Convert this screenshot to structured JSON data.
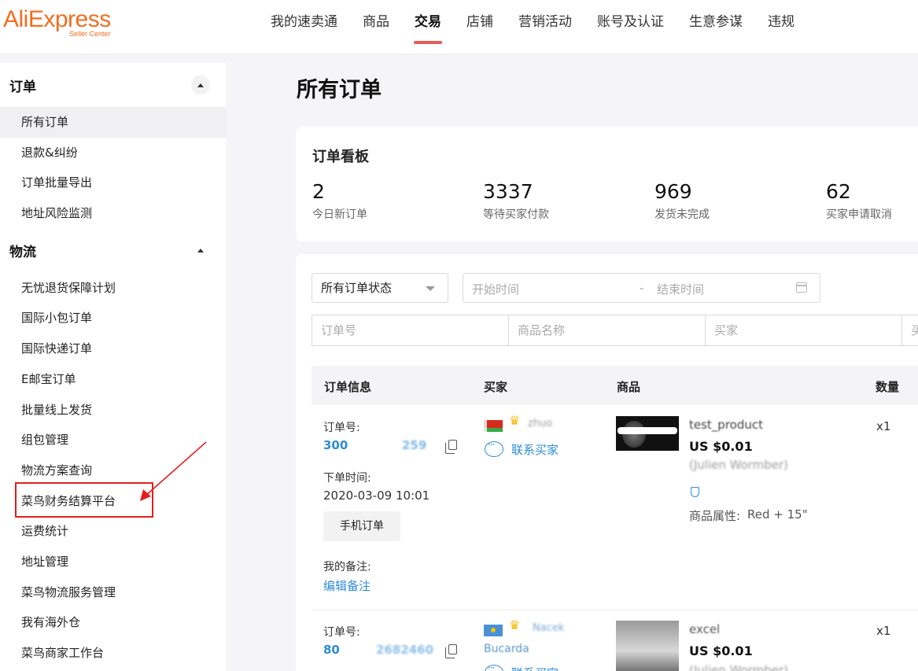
{
  "brand": {
    "name": "AliExpress",
    "sub": "Seller Center",
    "color": "#f26d21"
  },
  "nav": {
    "items": [
      "我的速卖通",
      "商品",
      "交易",
      "店铺",
      "营销活动",
      "账号及认证",
      "生意参谋",
      "违规"
    ],
    "active": "交易"
  },
  "sidebar": {
    "groups": [
      {
        "title": "订单",
        "items": [
          "所有订单",
          "退款&纠纷",
          "订单批量导出",
          "地址风险监测"
        ]
      },
      {
        "title": "物流",
        "items": [
          "无忧退货保障计划",
          "国际小包订单",
          "国际快递订单",
          "E邮宝订单",
          "批量线上发货",
          "组包管理",
          "物流方案查询",
          "菜鸟财务结算平台",
          "运费统计",
          "地址管理",
          "菜鸟物流服务管理",
          "我有海外仓",
          "菜鸟商家工作台"
        ]
      }
    ],
    "active_item": "所有订单",
    "highlighted_item": "菜鸟财务结算平台",
    "annotation_color": "#e41e1e"
  },
  "page": {
    "title": "所有订单"
  },
  "dashboard": {
    "title": "订单看板",
    "stats": [
      {
        "value": "2",
        "label": "今日新订单"
      },
      {
        "value": "3337",
        "label": "等待买家付款"
      },
      {
        "value": "969",
        "label": "发货未完成"
      },
      {
        "value": "62",
        "label": "买家申请取消"
      }
    ]
  },
  "filters": {
    "status_select": "所有订单状态",
    "date_start_placeholder": "开始时间",
    "date_separator": "-",
    "date_end_placeholder": "结束时间",
    "inputs": [
      "订单号",
      "商品名称",
      "买家",
      "买"
    ]
  },
  "table": {
    "headers": [
      "订单信息",
      "买家",
      "商品",
      "数量"
    ],
    "rows": [
      {
        "order_label": "订单号:",
        "order_no_start": "300",
        "order_no_end": "259",
        "time_label": "下单时间:",
        "time": "2020-03-09 10:01",
        "mobile_btn": "手机订单",
        "note_label": "我的备注:",
        "note_link": "编辑备注",
        "buyer_name": "zhuo",
        "contact": "联系买家",
        "product_title": "test_product",
        "price": "US $0.01",
        "brand": "(Julien Wormber)",
        "attr_label": "商品属性:",
        "attr_value": "Red + 15\"",
        "qty": "x1"
      },
      {
        "order_label": "订单号:",
        "order_no_start": "80",
        "order_no_end": "2682460",
        "buyer_name": "Nacek",
        "buyer_name2": "Bucarda",
        "contact": "联系买家",
        "product_title": "excel",
        "price": "US $0.01",
        "brand": "(Julien Wormber)",
        "qty": "x1"
      }
    ]
  },
  "accent_color": "#2d8cd6"
}
